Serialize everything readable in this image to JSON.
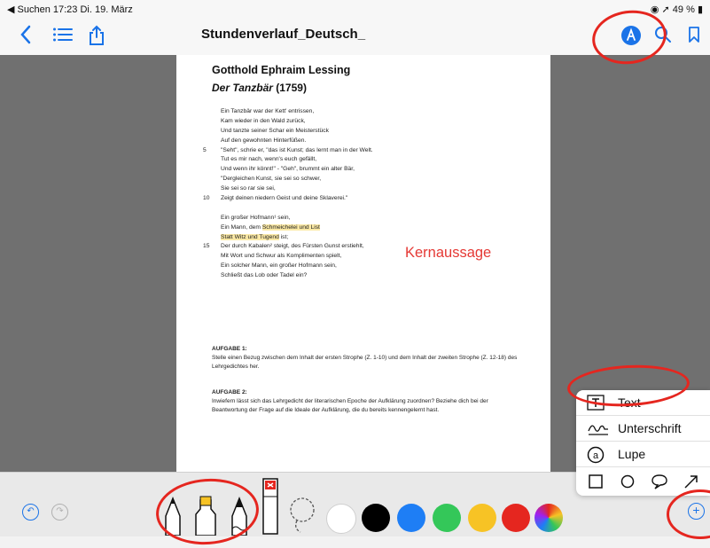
{
  "statusbar": {
    "back": "◀ Suchen",
    "time": "17:23",
    "date": "Di. 19. März",
    "battery": "49 %"
  },
  "navbar": {
    "doc_title": "Stundenverlauf_Deutsch_"
  },
  "document": {
    "author": "Gotthold Ephraim Lessing",
    "work_title": "Der Tanzbär",
    "work_year": "(1759)",
    "poem_lines": [
      {
        "no": "",
        "text": "Ein Tanzbär war der Kett' entrissen,"
      },
      {
        "no": "",
        "text": "Kam wieder in den Wald zurück,"
      },
      {
        "no": "",
        "text": "Und tanzte seiner Schar ein Meisterstück"
      },
      {
        "no": "",
        "text": "Auf den gewohnten Hinterfüßen."
      },
      {
        "no": "5",
        "text": "\"Seht\", schrie er, \"das ist Kunst; das lernt man in der Welt."
      },
      {
        "no": "",
        "text": "Tut es mir nach, wenn's euch gefällt,"
      },
      {
        "no": "",
        "text": "Und wenn ihr könnt!\" - \"Geh\", brummt ein alter Bär,"
      },
      {
        "no": "",
        "text": "\"Dergleichen Kunst, sie sei so schwer,"
      },
      {
        "no": "",
        "text": "Sie sei so rar sie sei,"
      },
      {
        "no": "10",
        "text": "Zeigt deinen niedern Geist und deine Sklaverei.\""
      },
      {
        "no": "",
        "text": ""
      },
      {
        "no": "",
        "text": "Ein großer Hofmann¹ sein,"
      },
      {
        "no": "",
        "text_before": "Ein Mann, dem ",
        "highlight": "Schmeichelei und List",
        "text_after": ""
      },
      {
        "no": "",
        "text_before": "",
        "highlight": "Statt Witz und Tugend",
        "text_after": " ist;"
      },
      {
        "no": "15",
        "text": "Der durch Kabalen² steigt, des Fürsten Gunst erstiehlt,"
      },
      {
        "no": "",
        "text": "Mit Wort und Schwur als Komplimenten spielt,"
      },
      {
        "no": "",
        "text": "Ein solcher Mann, ein großer Hofmann sein,"
      },
      {
        "no": "",
        "text": "Schließt das Lob oder Tadel ein?"
      }
    ],
    "annotation": "Kernaussage",
    "task1_head": "AUFGABE 1:",
    "task1_text": "Stelle einen Bezug zwischen dem Inhalt der ersten Strophe (Z. 1-10) und dem Inhalt der zweiten Strophe (Z. 12-18) des Lehrgedichtes her.",
    "task2_head": "AUFGABE 2:",
    "task2_text": "Inwiefern lässt sich das Lehrgedicht der literarischen Epoche der Aufklärung zuordnen? Beziehe dich bei der Beantwortung der Frage auf die Ideale der Aufklärung, die du bereits kennengelernt hast."
  },
  "popup_menu": {
    "items": [
      {
        "icon": "text-box-icon",
        "label": "Text"
      },
      {
        "icon": "signature-icon",
        "label": "Unterschrift"
      },
      {
        "icon": "magnifier-icon",
        "label": "Lupe"
      }
    ]
  },
  "palette": {
    "colors": [
      "#ffffff",
      "#000000",
      "#1e7ef5",
      "#34c759",
      "#f7c325",
      "#e5261f"
    ],
    "accent": "#1a73e8",
    "annotation_color": "#e5261f"
  }
}
